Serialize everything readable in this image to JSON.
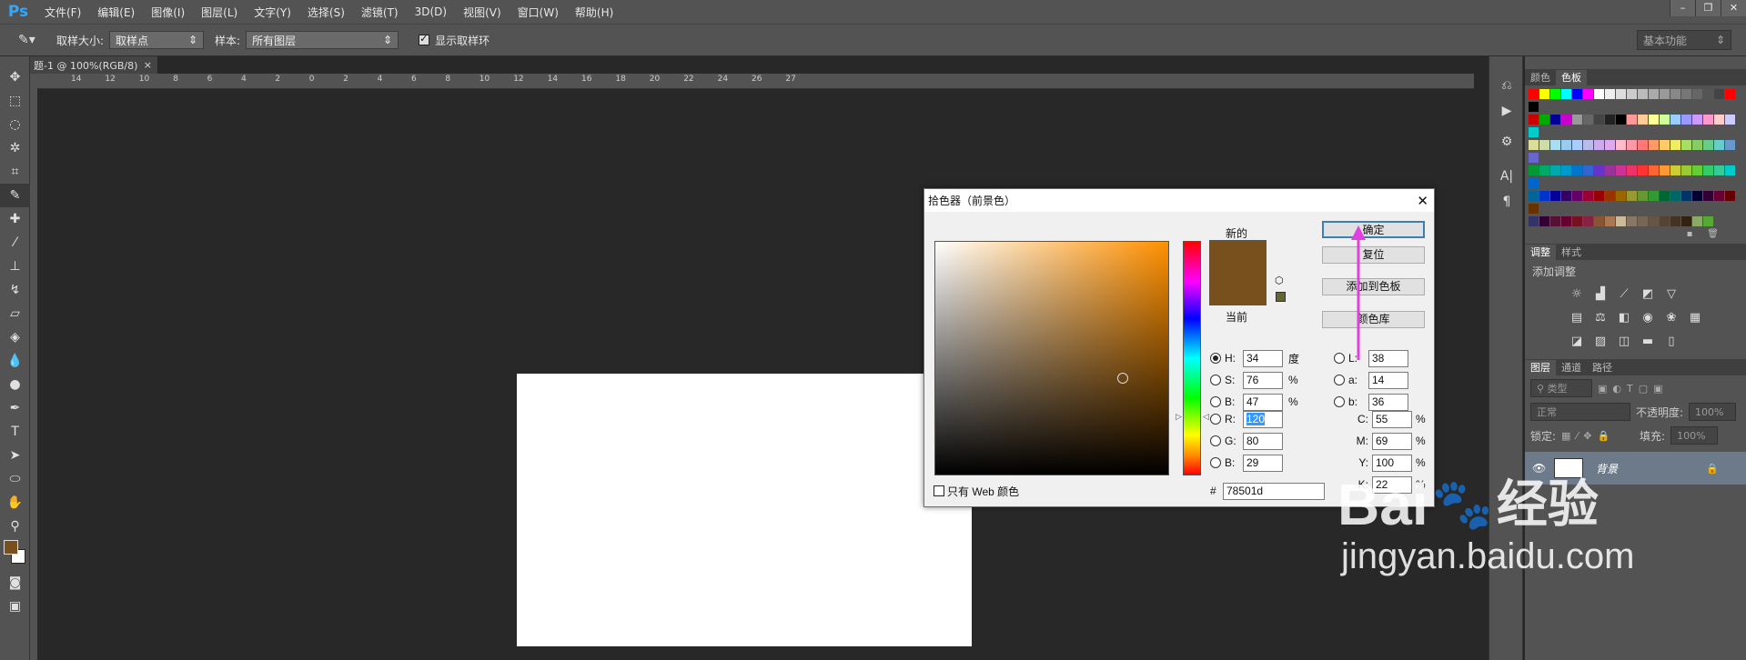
{
  "app": {
    "logo": "Ps"
  },
  "menu": [
    "文件(F)",
    "编辑(E)",
    "图像(I)",
    "图层(L)",
    "文字(Y)",
    "选择(S)",
    "滤镜(T)",
    "3D(D)",
    "视图(V)",
    "窗口(W)",
    "帮助(H)"
  ],
  "options": {
    "sample_size_label": "取样大小:",
    "sample_size_value": "取样点",
    "sample_label": "样本:",
    "sample_value": "所有图层",
    "show_ring_label": "显示取样环",
    "workspace": "基本功能"
  },
  "document": {
    "tab": "题-1 @ 100%(RGB/8)"
  },
  "ruler_ticks": [
    "14",
    "12",
    "10",
    "8",
    "6",
    "4",
    "2",
    "0",
    "2",
    "4",
    "6",
    "8",
    "10",
    "12",
    "14",
    "16",
    "18",
    "20",
    "22",
    "24",
    "26",
    "27"
  ],
  "panels": {
    "top_tabs": [
      "颜色",
      "色板"
    ],
    "adj_tabs": [
      "调整",
      "样式"
    ],
    "adj_title": "添加调整",
    "layer_tabs": [
      "图层",
      "通道",
      "路径"
    ],
    "kind": "类型",
    "blend": "正常",
    "opacity_label": "不透明度:",
    "opacity": "100%",
    "lock_label": "锁定:",
    "fill_label": "填充:",
    "fill": "100%",
    "layer_name": "背景"
  },
  "dialog": {
    "title": "拾色器（前景色）",
    "new_label": "新的",
    "current_label": "当前",
    "ok": "确定",
    "reset": "复位",
    "add_swatch": "添加到色板",
    "color_libraries": "颜色库",
    "web_only": "只有 Web 颜色",
    "hsb": [
      {
        "k": "H:",
        "v": "34",
        "u": "度"
      },
      {
        "k": "S:",
        "v": "76",
        "u": "%"
      },
      {
        "k": "B:",
        "v": "47",
        "u": "%"
      }
    ],
    "rgb": [
      {
        "k": "R:",
        "v": "120"
      },
      {
        "k": "G:",
        "v": "80"
      },
      {
        "k": "B:",
        "v": "29"
      }
    ],
    "lab": [
      {
        "k": "L:",
        "v": "38"
      },
      {
        "k": "a:",
        "v": "14"
      },
      {
        "k": "b:",
        "v": "36"
      }
    ],
    "cmyk": [
      {
        "k": "C:",
        "v": "55"
      },
      {
        "k": "M:",
        "v": "69"
      },
      {
        "k": "Y:",
        "v": "100"
      },
      {
        "k": "K:",
        "v": "22"
      }
    ],
    "percent": "%",
    "hash": "#",
    "hex": "78501d"
  },
  "colors": {
    "foreground": "#78501d",
    "arrow": "#e040e0"
  },
  "watermark": {
    "brand": "Bai",
    "brand2": "经验",
    "url": "jingyan.baidu.com"
  }
}
